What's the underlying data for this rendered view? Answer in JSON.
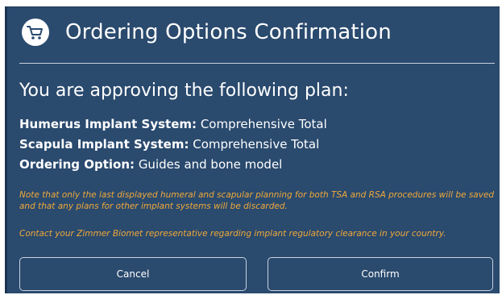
{
  "dialog": {
    "title": "Ordering Options Confirmation",
    "icon": "shopping-cart-icon",
    "heading": "You are approving the following plan:",
    "details": [
      {
        "label": "Humerus Implant System:",
        "value": "Comprehensive Total"
      },
      {
        "label": "Scapula Implant System:",
        "value": "Comprehensive Total"
      },
      {
        "label": "Ordering Option:",
        "value": "Guides and bone model"
      }
    ],
    "notes": [
      "Note that only the last displayed humeral and scapular planning for both TSA and RSA procedures will be saved and that any plans for other implant systems will be discarded.",
      "Contact your Zimmer Biomet representative regarding implant regulatory clearance in your country."
    ],
    "buttons": {
      "cancel": "Cancel",
      "confirm": "Confirm"
    }
  },
  "colors": {
    "background": "#2a4a6e",
    "note_text": "#f0a93a",
    "text": "#ffffff"
  }
}
